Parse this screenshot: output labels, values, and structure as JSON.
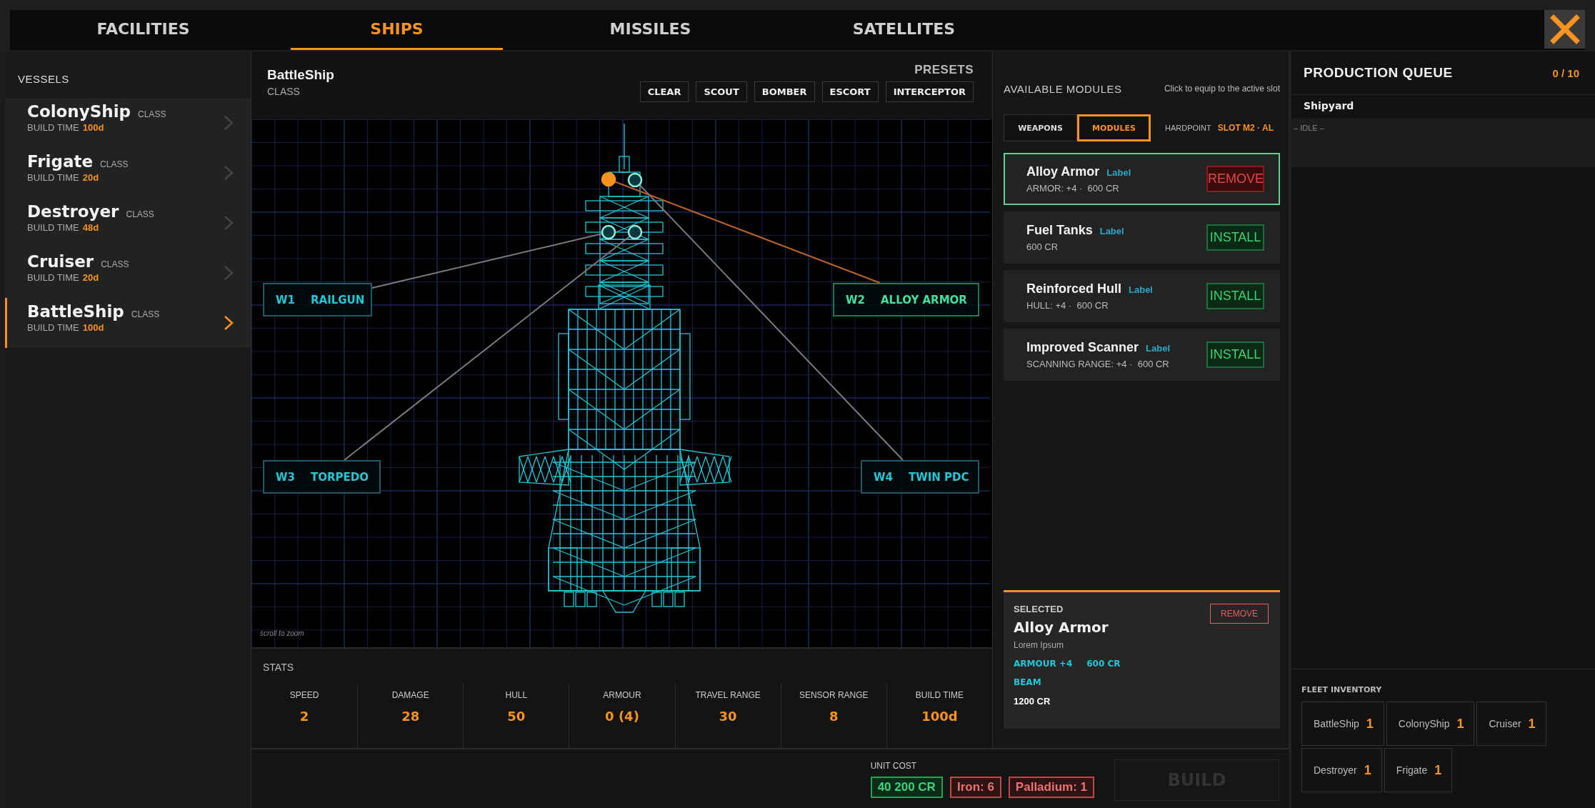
{
  "tabs": [
    {
      "label": "FACILITIES",
      "selected": false
    },
    {
      "label": "SHIPS",
      "selected": true
    },
    {
      "label": "MISSILES",
      "selected": false
    },
    {
      "label": "SATELLITES",
      "selected": false
    }
  ],
  "sidebar": {
    "title": "VESSELS",
    "items": [
      {
        "name": "ColonyShip",
        "class_label": "CLASS",
        "build_label": "BUILD TIME",
        "build_time": "100d",
        "selected": false
      },
      {
        "name": "Frigate",
        "class_label": "CLASS",
        "build_label": "BUILD TIME",
        "build_time": "20d",
        "selected": false
      },
      {
        "name": "Destroyer",
        "class_label": "CLASS",
        "build_label": "BUILD TIME",
        "build_time": "48d",
        "selected": false
      },
      {
        "name": "Cruiser",
        "class_label": "CLASS",
        "build_label": "BUILD TIME",
        "build_time": "20d",
        "selected": false
      },
      {
        "name": "BattleShip",
        "class_label": "CLASS",
        "build_label": "BUILD TIME",
        "build_time": "100d",
        "selected": true
      }
    ]
  },
  "designer": {
    "ship_name": "BattleShip",
    "ship_class": "CLASS",
    "presets_title": "PRESETS",
    "presets": [
      "CLEAR",
      "SCOUT",
      "BOMBER",
      "ESCORT",
      "INTERCEPTOR"
    ],
    "hardpoints": [
      {
        "slot": "W1",
        "label": "RAILGUN",
        "selected": false
      },
      {
        "slot": "W2",
        "label": "ALLOY ARMOR",
        "selected": true
      },
      {
        "slot": "W3",
        "label": "TORPEDO",
        "selected": false
      },
      {
        "slot": "W4",
        "label": "TWIN PDC",
        "selected": false
      }
    ],
    "hint": "scroll to zoom"
  },
  "stats": {
    "title": "STATS",
    "items": [
      {
        "label": "SPEED",
        "value": "2"
      },
      {
        "label": "DAMAGE",
        "value": "28"
      },
      {
        "label": "HULL",
        "value": "50"
      },
      {
        "label": "ARMOUR",
        "value": "0 (4)"
      },
      {
        "label": "TRAVEL RANGE",
        "value": "30"
      },
      {
        "label": "SENSOR RANGE",
        "value": "8"
      },
      {
        "label": "BUILD TIME",
        "value": "100d"
      }
    ]
  },
  "modules": {
    "title": "AVAILABLE MODULES",
    "hint": "Click to equip to the active slot",
    "tabs": [
      {
        "label": "WEAPONS",
        "selected": false
      },
      {
        "label": "MODULES",
        "selected": true
      }
    ],
    "hardpoint_label": "HARDPOINT",
    "hardpoint_value": "SLOT M2 · AL",
    "items": [
      {
        "name": "Alloy Armor",
        "tag": "Label",
        "detail": "ARMOR: +4 ·  600 CR",
        "action": "REMOVE",
        "equipped": true
      },
      {
        "name": "Fuel Tanks",
        "tag": "Label",
        "detail": "600 CR",
        "action": "INSTALL",
        "equipped": false
      },
      {
        "name": "Reinforced Hull",
        "tag": "Label",
        "detail": "HULL: +4 ·  600 CR",
        "action": "INSTALL",
        "equipped": false
      },
      {
        "name": "Improved Scanner",
        "tag": "Label",
        "detail": "SCANNING RANGE: +4 ·  600 CR",
        "action": "INSTALL",
        "equipped": false
      }
    ]
  },
  "selected": {
    "title": "SELECTED",
    "remove": "REMOVE",
    "name": "Alloy Armor",
    "description": "Lorem Ipsum",
    "tag_rows": [
      [
        "ARMOUR +4",
        "600 CR"
      ],
      [
        "BEAM"
      ]
    ],
    "price": "1200 CR"
  },
  "cost": {
    "label": "UNIT COST",
    "chips": [
      {
        "text": "40 200 CR",
        "kind": "credits"
      },
      {
        "text": "Iron: 6",
        "kind": "shortfall"
      },
      {
        "text": "Palladium: 1",
        "kind": "shortfall"
      }
    ]
  },
  "build_button": {
    "label": "BUILD",
    "disabled": true
  },
  "queue": {
    "title": "PRODUCTION QUEUE",
    "count": "0 / 10",
    "facility": "Shipyard",
    "status": "– IDLE –"
  },
  "fleet": {
    "title": "FLEET INVENTORY",
    "items": [
      {
        "name": "BattleShip",
        "count": "1"
      },
      {
        "name": "ColonyShip",
        "count": "1"
      },
      {
        "name": "Cruiser",
        "count": "1"
      },
      {
        "name": "Destroyer",
        "count": "1"
      },
      {
        "name": "Frigate",
        "count": "1"
      }
    ]
  }
}
